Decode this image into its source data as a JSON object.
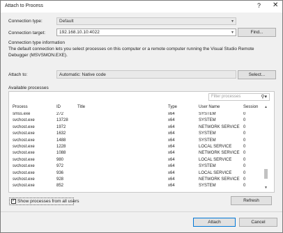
{
  "window": {
    "title": "Attach to Process",
    "help": "?",
    "close": "✕"
  },
  "connection_type": {
    "label": "Connection type:",
    "value": "Default",
    "arrow": "▾"
  },
  "connection_target": {
    "label": "Connection target:",
    "value": "192.168.10.10:4022",
    "arrow": "▾",
    "find_label": "Find..."
  },
  "info": {
    "heading": "Connection type information",
    "text": "The default connection lets you select processes on this computer or a remote computer running the Visual Studio Remote Debugger (MSVSMON.EXE)."
  },
  "attach_to": {
    "label": "Attach to:",
    "value": "Automatic: Native code",
    "select_label": "Select..."
  },
  "available": {
    "label": "Available processes",
    "filter_placeholder": "Filter processes",
    "search_icon": "search-icon",
    "columns": {
      "process": "Process",
      "id": "ID",
      "title": "Title",
      "type": "Type",
      "user": "User Name",
      "session": "Session"
    },
    "rows": [
      {
        "process": "smss.exe",
        "id": "272",
        "title": "",
        "type": "x64",
        "user": "SYSTEM",
        "session": "0"
      },
      {
        "process": "svchost.exe",
        "id": "13728",
        "title": "",
        "type": "x64",
        "user": "SYSTEM",
        "session": "0"
      },
      {
        "process": "svchost.exe",
        "id": "1972",
        "title": "",
        "type": "x64",
        "user": "NETWORK SERVICE",
        "session": "0"
      },
      {
        "process": "svchost.exe",
        "id": "1632",
        "title": "",
        "type": "x64",
        "user": "SYSTEM",
        "session": "0"
      },
      {
        "process": "svchost.exe",
        "id": "1488",
        "title": "",
        "type": "x64",
        "user": "SYSTEM",
        "session": "0"
      },
      {
        "process": "svchost.exe",
        "id": "1228",
        "title": "",
        "type": "x64",
        "user": "LOCAL SERVICE",
        "session": "0"
      },
      {
        "process": "svchost.exe",
        "id": "1088",
        "title": "",
        "type": "x64",
        "user": "NETWORK SERVICE",
        "session": "0"
      },
      {
        "process": "svchost.exe",
        "id": "980",
        "title": "",
        "type": "x64",
        "user": "LOCAL SERVICE",
        "session": "0"
      },
      {
        "process": "svchost.exe",
        "id": "972",
        "title": "",
        "type": "x64",
        "user": "SYSTEM",
        "session": "0"
      },
      {
        "process": "svchost.exe",
        "id": "936",
        "title": "",
        "type": "x64",
        "user": "LOCAL SERVICE",
        "session": "0"
      },
      {
        "process": "svchost.exe",
        "id": "928",
        "title": "",
        "type": "x64",
        "user": "NETWORK SERVICE",
        "session": "0"
      },
      {
        "process": "svchost.exe",
        "id": "852",
        "title": "",
        "type": "x64",
        "user": "SYSTEM",
        "session": "0"
      }
    ]
  },
  "show_all": {
    "label": "Show processes from all users",
    "checked": "✓"
  },
  "buttons": {
    "refresh": "Refresh",
    "attach": "Attach",
    "cancel": "Cancel"
  },
  "scroll": {
    "up": "▲",
    "down": "▼"
  },
  "colors": {
    "accent": "#0078d7",
    "panel_bg": "#f0f0f0"
  }
}
